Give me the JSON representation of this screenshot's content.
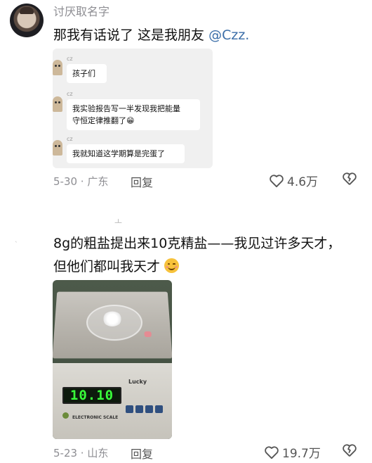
{
  "comment1": {
    "username": "讨厌取名字",
    "text_before_mention": "那我有话说了 这是我朋友 ",
    "mention": "@Czz.",
    "chat": {
      "messages": [
        {
          "sender": "cz",
          "text": "孩子们"
        },
        {
          "sender": "cz",
          "line1": "我实验报告写一半发现我把能量",
          "line2": "守恒定律推翻了😁"
        },
        {
          "sender": "cz",
          "text": "我就知道这学期算是完蛋了"
        }
      ]
    },
    "date_location": "5-30 · 广东",
    "reply": "回复",
    "likes": "4.6万"
  },
  "comment2": {
    "top_mark": "ㅗ",
    "side_mark": "`",
    "text_line1": "8g的粗盐提出来10克精盐——我见过许多天才，",
    "text_line2": "但他们都叫我天才",
    "photo": {
      "display_value": "10.10",
      "brand": "Lucky",
      "label": "ELECTRONIC SCALE"
    },
    "date_location": "5-23 · 山东",
    "reply": "回复",
    "likes": "19.7万"
  },
  "icons": {
    "like": "heart-outline-icon",
    "dislike": "broken-heart-icon",
    "accent": "#3b6ea8"
  }
}
